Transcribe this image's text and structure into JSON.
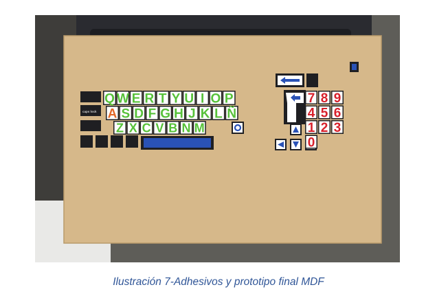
{
  "figure": {
    "caption": "Ilustración 7-Adhesivos y prototipo final MDF",
    "colors": {
      "caption": "#2f5597",
      "mdf_board": "#d6b88a",
      "green_key": "#57c13a",
      "orange_key": "#e46a2a",
      "red_key": "#d8202b",
      "blue_key": "#2a52b6"
    },
    "keyboard": {
      "row1": [
        "Q",
        "W",
        "E",
        "R",
        "T",
        "Y",
        "U",
        "I",
        "O",
        "P"
      ],
      "row2": [
        "A",
        "S",
        "D",
        "F",
        "G",
        "H",
        "J",
        "K",
        "L",
        "Ñ"
      ],
      "row3": [
        "Z",
        "X",
        "C",
        "V",
        "B",
        "N",
        "M"
      ],
      "numpad": [
        [
          "7",
          "8",
          "9"
        ],
        [
          "4",
          "5",
          "6"
        ],
        [
          "1",
          "2",
          "3"
        ],
        [
          "0"
        ]
      ],
      "left_keys": [
        "caps lock"
      ],
      "arrow_icons": [
        "arrow-up-icon",
        "arrow-left-icon",
        "arrow-down-icon",
        "arrow-right-icon",
        "backspace-arrow-icon",
        "enter-arrow-icon"
      ]
    }
  }
}
